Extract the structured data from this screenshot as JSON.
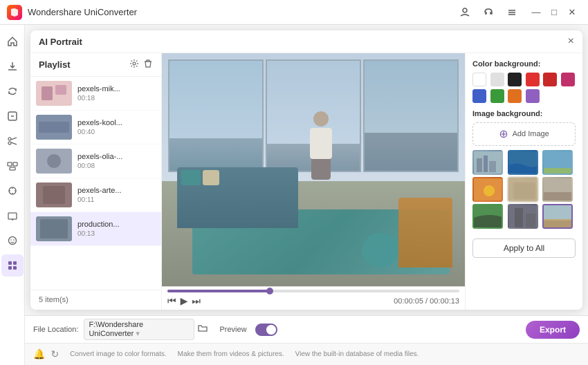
{
  "titleBar": {
    "appName": "Wondershare UniConverter",
    "icons": [
      "profile",
      "headset",
      "hamburger"
    ],
    "winControls": [
      "minimize",
      "maximize",
      "close"
    ]
  },
  "dialog": {
    "title": "AI Portrait",
    "closeLabel": "×"
  },
  "playlist": {
    "title": "Playlist",
    "itemCount": "5 item(s)",
    "items": [
      {
        "name": "pexels-mik...",
        "duration": "00:18",
        "active": false
      },
      {
        "name": "pexels-kool...",
        "duration": "00:40",
        "active": false
      },
      {
        "name": "pexels-olia-...",
        "duration": "00:08",
        "active": false
      },
      {
        "name": "pexels-arte...",
        "duration": "00:11",
        "active": false
      },
      {
        "name": "production...",
        "duration": "00:13",
        "active": true
      }
    ]
  },
  "videoControls": {
    "currentTime": "00:00:05",
    "totalTime": "00:00:13",
    "separator": "/"
  },
  "rightPanel": {
    "colorSection": {
      "title": "Color background:",
      "colors": [
        {
          "id": "white",
          "label": "White"
        },
        {
          "id": "lightgray",
          "label": "Light Gray"
        },
        {
          "id": "black",
          "label": "Black"
        },
        {
          "id": "red",
          "label": "Red"
        },
        {
          "id": "darkred",
          "label": "Dark Red"
        },
        {
          "id": "magenta",
          "label": "Magenta"
        },
        {
          "id": "blue",
          "label": "Blue"
        },
        {
          "id": "green",
          "label": "Green"
        },
        {
          "id": "orange",
          "label": "Orange"
        },
        {
          "id": "purple",
          "label": "Purple"
        }
      ]
    },
    "imageSection": {
      "title": "Image background:",
      "addButtonLabel": "Add Image",
      "images": [
        {
          "id": "city1",
          "selected": false
        },
        {
          "id": "water",
          "selected": false
        },
        {
          "id": "sky",
          "selected": false
        },
        {
          "id": "sunset",
          "selected": false
        },
        {
          "id": "blur",
          "selected": false
        },
        {
          "id": "indoor",
          "selected": false
        },
        {
          "id": "green",
          "selected": false
        },
        {
          "id": "building",
          "selected": false
        },
        {
          "id": "room",
          "selected": true
        }
      ]
    },
    "applyButton": "Apply to All"
  },
  "bottomBar": {
    "fileLocationLabel": "File Location:",
    "fileLocationValue": "F:\\Wondershare UniConverter",
    "previewLabel": "Preview",
    "exportLabel": "Export"
  },
  "infoBar": {
    "items": [
      "Convert image to color formats.",
      "Make them from videos & pictures.",
      "View the built-in database of media files."
    ]
  },
  "sidebar": {
    "items": [
      {
        "id": "home",
        "icon": "⌂"
      },
      {
        "id": "download",
        "icon": "↓"
      },
      {
        "id": "convert",
        "icon": "⇄"
      },
      {
        "id": "compress",
        "icon": "⊡"
      },
      {
        "id": "scissors",
        "icon": "✂"
      },
      {
        "id": "merge",
        "icon": "⊞"
      },
      {
        "id": "effects",
        "icon": "✦"
      },
      {
        "id": "tv",
        "icon": "▣"
      },
      {
        "id": "face",
        "icon": "◉"
      },
      {
        "id": "grid",
        "icon": "⊞",
        "active": true
      }
    ]
  }
}
